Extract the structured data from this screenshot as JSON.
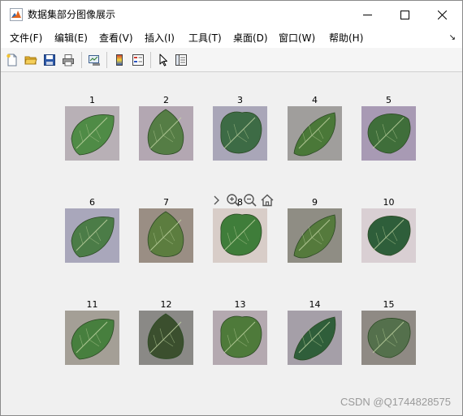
{
  "window": {
    "title": "数据集部分图像展示",
    "minimize_glyph": "—",
    "maximize_glyph": "☐",
    "close_glyph": "✕"
  },
  "menubar": {
    "items": [
      {
        "label": "文件(F)"
      },
      {
        "label": "编辑(E)"
      },
      {
        "label": "查看(V)"
      },
      {
        "label": "插入(I)"
      },
      {
        "label": "工具(T)"
      },
      {
        "label": "桌面(D)"
      },
      {
        "label": "窗口(W)"
      },
      {
        "label": "帮助(H)"
      }
    ],
    "dock_arrow": "↘"
  },
  "toolbar": {
    "icons": [
      "new-figure-icon",
      "open-file-icon",
      "save-icon",
      "print-icon",
      "link-plot-icon",
      "colorbar-icon",
      "legend-icon",
      "edit-plot-arrow-icon",
      "property-inspector-icon"
    ]
  },
  "axes_toolbar": {
    "icons": [
      "chevron-right-icon",
      "zoom-in-icon",
      "zoom-out-icon",
      "home-icon"
    ]
  },
  "images": {
    "labels": [
      "1",
      "2",
      "3",
      "4",
      "5",
      "6",
      "7",
      "8",
      "9",
      "10",
      "11",
      "12",
      "13",
      "14",
      "15"
    ],
    "bg_colors": [
      "#b8b0b6",
      "#b3a7b2",
      "#a9a6b8",
      "#a09e9c",
      "#a89ab4",
      "#a9a7bb",
      "#9a8e84",
      "#d8cdc8",
      "#8f8d84",
      "#d9cfd3",
      "#a49f96",
      "#8a8986",
      "#b4a9b0",
      "#a59fa8",
      "#8f8a84"
    ],
    "leaf_colors": [
      "#4f8b46",
      "#557d45",
      "#3d6b45",
      "#4a7838",
      "#3f6e3a",
      "#4b7c47",
      "#5c7d3f",
      "#3f7d3a",
      "#557a3c",
      "#2e5e3a",
      "#477f3e",
      "#3b4f2e",
      "#4e7a3a",
      "#2f5e3a",
      "#54704c"
    ]
  },
  "watermark": "CSDN @Q1744828575"
}
